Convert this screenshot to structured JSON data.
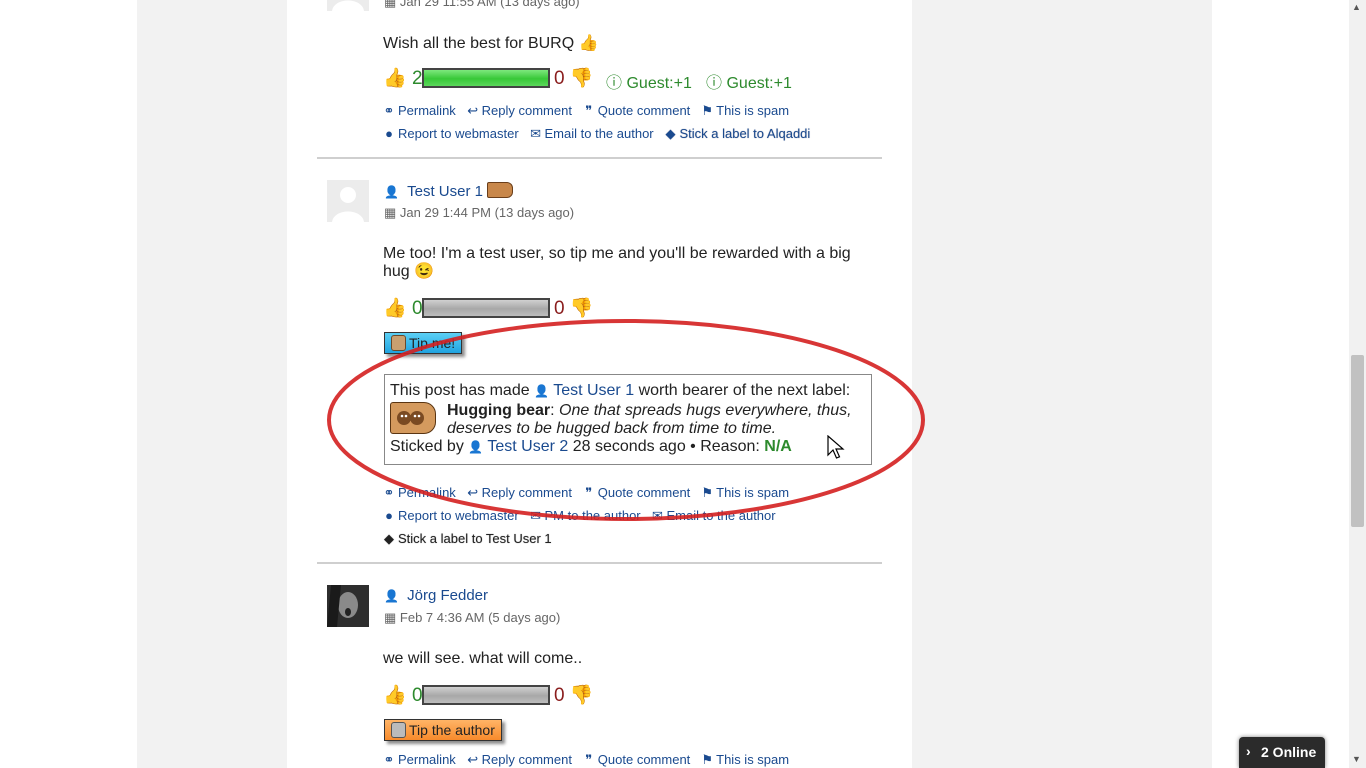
{
  "comments": [
    {
      "date": "Jan 29 11:55 AM (13 days ago)",
      "body": "Wish all the best for BURQ",
      "likes": "2",
      "dislikes": "0",
      "guest_votes": [
        "Guest:+1",
        "Guest:+1"
      ],
      "actions": {
        "permalink": "Permalink",
        "reply": "Reply comment",
        "quote": "Quote comment",
        "spam": "This is spam",
        "report": "Report to webmaster",
        "email": "Email to the author",
        "stick": "Stick a label to Alqaddi"
      }
    },
    {
      "author": "Test User 1",
      "date": "Jan 29 1:44 PM (13 days ago)",
      "body": "Me too! I'm a test user, so tip me and you'll be rewarded with a big hug",
      "likes": "0",
      "dislikes": "0",
      "tip_button": "Tip me!",
      "label_box": {
        "intro": "This post has made",
        "user": "Test User 1",
        "worth": "worth bearer of the next label:",
        "label_name": "Hugging bear",
        "label_desc_line1": "One that spreads hugs everywhere, thus,",
        "label_desc_line2": "deserves to be hugged back from time to time.",
        "sticked_by": "Sticked by",
        "sticker": "Test User 2",
        "ago": "28 seconds ago • Reason:",
        "reason": "N/A"
      },
      "actions": {
        "permalink": "Permalink",
        "reply": "Reply comment",
        "quote": "Quote comment",
        "spam": "This is spam",
        "report": "Report to webmaster",
        "pm": "PM to the author",
        "email": "Email to the author",
        "stick": "Stick a label to Test User 1"
      }
    },
    {
      "author": "Jörg Fedder",
      "date": "Feb 7 4:36 AM (5 days ago)",
      "body": "we will see. what will come..",
      "likes": "0",
      "dislikes": "0",
      "tip_button": "Tip the author",
      "actions": {
        "permalink": "Permalink",
        "reply": "Reply comment",
        "quote": "Quote comment",
        "spam": "This is spam"
      }
    }
  ],
  "online_widget": "2 Online",
  "colors": {
    "link": "#1a4a8f",
    "like_green": "#2d8a2d",
    "dislike_red": "#8a1d1d",
    "annotation_ellipse": "#d42020"
  }
}
